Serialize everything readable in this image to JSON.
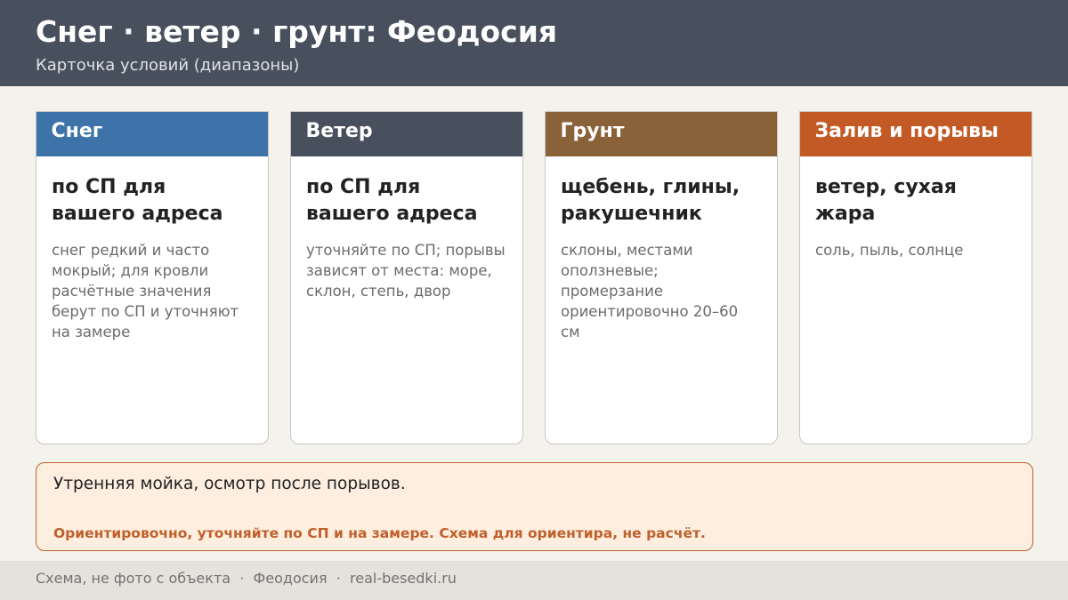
{
  "header": {
    "title": "Снег · ветер · грунт: Феодосия",
    "subtitle": "Карточка условий (диапазоны)"
  },
  "cards": [
    {
      "label": "Снег",
      "color": "#3d73a8",
      "main": "по СП для вашего адреса",
      "note": "снег редкий и часто мокрый; для кровли расчётные значения берут по СП и уточняют на замере"
    },
    {
      "label": "Ветер",
      "color": "#47505c",
      "main": "по СП для вашего адреса",
      "note": "уточняйте по СП; порывы зависят от места: море, склон, степь, двор"
    },
    {
      "label": "Грунт",
      "color": "#8a6239",
      "main": "щебень, глины, ракушечник",
      "note": "склоны, местами оползневые; промерзание ориентировочно 20–60 см"
    },
    {
      "label": "Залив и порывы",
      "color": "#c35a26",
      "main": "ветер, сухая жара",
      "note": "соль, пыль, солнце"
    }
  ],
  "note_box": {
    "text": "Утренняя мойка, осмотр после порывов.",
    "warning": "Ориентировочно, уточняйте по СП и на замере. Схема для ориентира, не расчёт."
  },
  "footer": {
    "text": "Схема, не фото с объекта  ·  Феодосия  ·  real-besedki.ru"
  }
}
